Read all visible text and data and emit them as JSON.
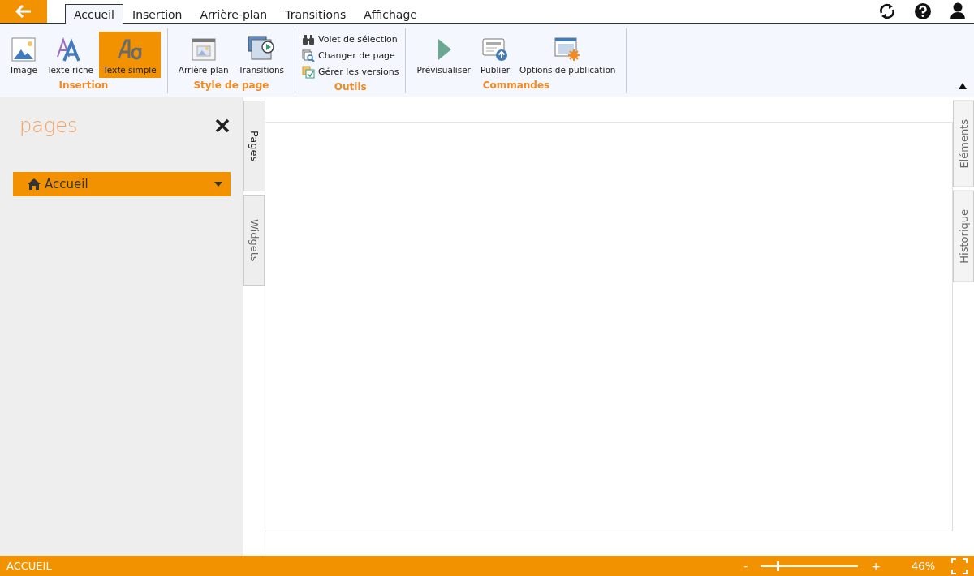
{
  "menu_tabs": [
    {
      "label": "Accueil",
      "selected": true
    },
    {
      "label": "Insertion",
      "selected": false
    },
    {
      "label": "Arrière-plan",
      "selected": false
    },
    {
      "label": "Transitions",
      "selected": false
    },
    {
      "label": "Affichage",
      "selected": false
    }
  ],
  "ribbon_groups": [
    {
      "title": "Insertion",
      "items": [
        {
          "kind": "large",
          "label": "Image",
          "selected": false
        },
        {
          "kind": "large",
          "label": "Texte riche",
          "selected": false
        },
        {
          "kind": "large",
          "label": "Texte simple",
          "selected": true
        }
      ]
    },
    {
      "title": "Style de page",
      "items": [
        {
          "kind": "large",
          "label": "Arrière-plan",
          "selected": false
        },
        {
          "kind": "large",
          "label": "Transitions",
          "selected": false
        }
      ]
    },
    {
      "title": "Outils",
      "items": [
        {
          "kind": "small",
          "label": "Volet de sélection"
        },
        {
          "kind": "small",
          "label": "Changer de page"
        },
        {
          "kind": "small",
          "label": "Gérer les versions"
        }
      ]
    },
    {
      "title": "Commandes",
      "items": [
        {
          "kind": "large",
          "label": "Prévisualiser",
          "selected": false
        },
        {
          "kind": "large",
          "label": "Publier",
          "selected": false
        },
        {
          "kind": "large",
          "label": "Options de publication",
          "selected": false
        }
      ]
    }
  ],
  "panel": {
    "title": "pages",
    "page_select": {
      "value": "Accueil"
    }
  },
  "left_tabs": [
    {
      "label": "Pages",
      "selected": true
    },
    {
      "label": "Widgets",
      "selected": false
    }
  ],
  "right_tabs": [
    {
      "label": "Eléments",
      "selected": false
    },
    {
      "label": "Historique",
      "selected": false
    }
  ],
  "status_bar": {
    "page": "ACCUEIL",
    "zoom_out": "-",
    "zoom_in": "+",
    "zoom": {
      "level": 0.17
    },
    "zoom_reading": "46%"
  }
}
